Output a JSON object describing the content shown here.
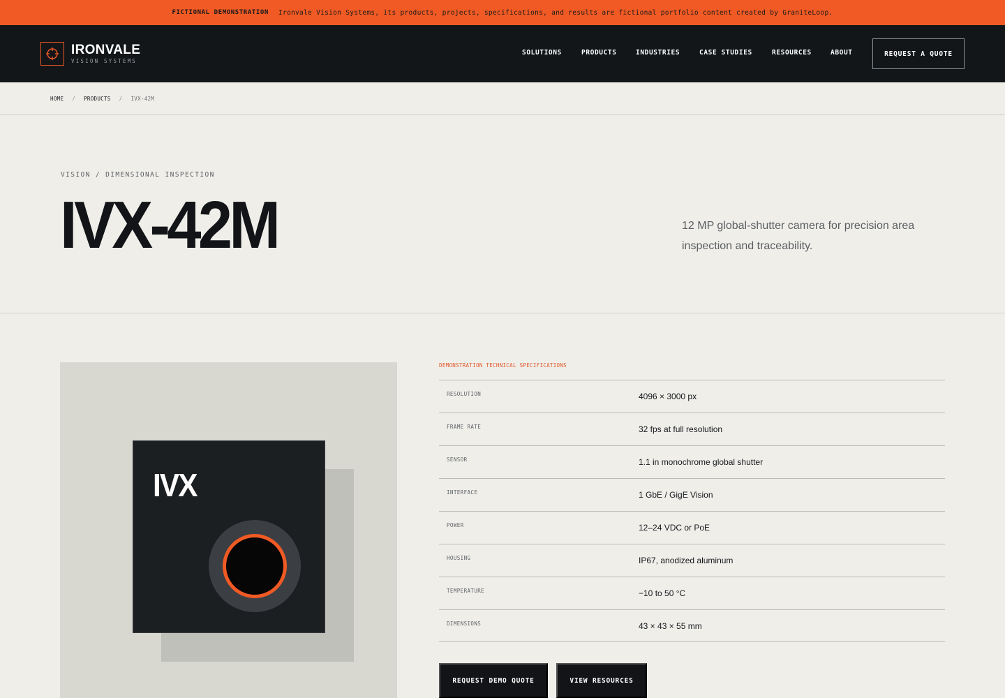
{
  "notice": {
    "tag": "FICTIONAL DEMONSTRATION",
    "message": "Ironvale Vision Systems, its products, projects, specifications, and results are fictional portfolio content created by GraniteLoop."
  },
  "brand": {
    "name": "IRONVALE",
    "tagline": "VISION SYSTEMS",
    "accent_color": "#f15a24",
    "icon": "crosshair-icon"
  },
  "nav": {
    "items": [
      {
        "label": "SOLUTIONS"
      },
      {
        "label": "PRODUCTS"
      },
      {
        "label": "INDUSTRIES"
      },
      {
        "label": "CASE STUDIES"
      },
      {
        "label": "RESOURCES"
      },
      {
        "label": "ABOUT"
      }
    ],
    "cta_label": "REQUEST A QUOTE"
  },
  "breadcrumb": {
    "items": [
      "HOME",
      "PRODUCTS"
    ],
    "separator": "/",
    "current": "IVX-42M"
  },
  "hero": {
    "eyebrow": "VISION / DIMENSIONAL INSPECTION",
    "title": "IVX-42M",
    "lead": "12 MP global-shutter camera for precision area inspection and traceability."
  },
  "product_image": {
    "label": "IVX"
  },
  "specs": {
    "heading": "DEMONSTRATION TECHNICAL SPECIFICATIONS",
    "rows": [
      {
        "key": "RESOLUTION",
        "value": "4096 × 3000 px"
      },
      {
        "key": "FRAME RATE",
        "value": "32 fps at full resolution"
      },
      {
        "key": "SENSOR",
        "value": "1.1 in monochrome global shutter"
      },
      {
        "key": "INTERFACE",
        "value": "1 GbE / GigE Vision"
      },
      {
        "key": "POWER",
        "value": "12–24 VDC or PoE"
      },
      {
        "key": "HOUSING",
        "value": "IP67, anodized aluminum"
      },
      {
        "key": "TEMPERATURE",
        "value": "−10 to 50 °C"
      },
      {
        "key": "DIMENSIONS",
        "value": "43 × 43 × 55 mm"
      }
    ]
  },
  "actions": {
    "primary_label": "REQUEST DEMO QUOTE",
    "secondary_label": "VIEW RESOURCES"
  }
}
